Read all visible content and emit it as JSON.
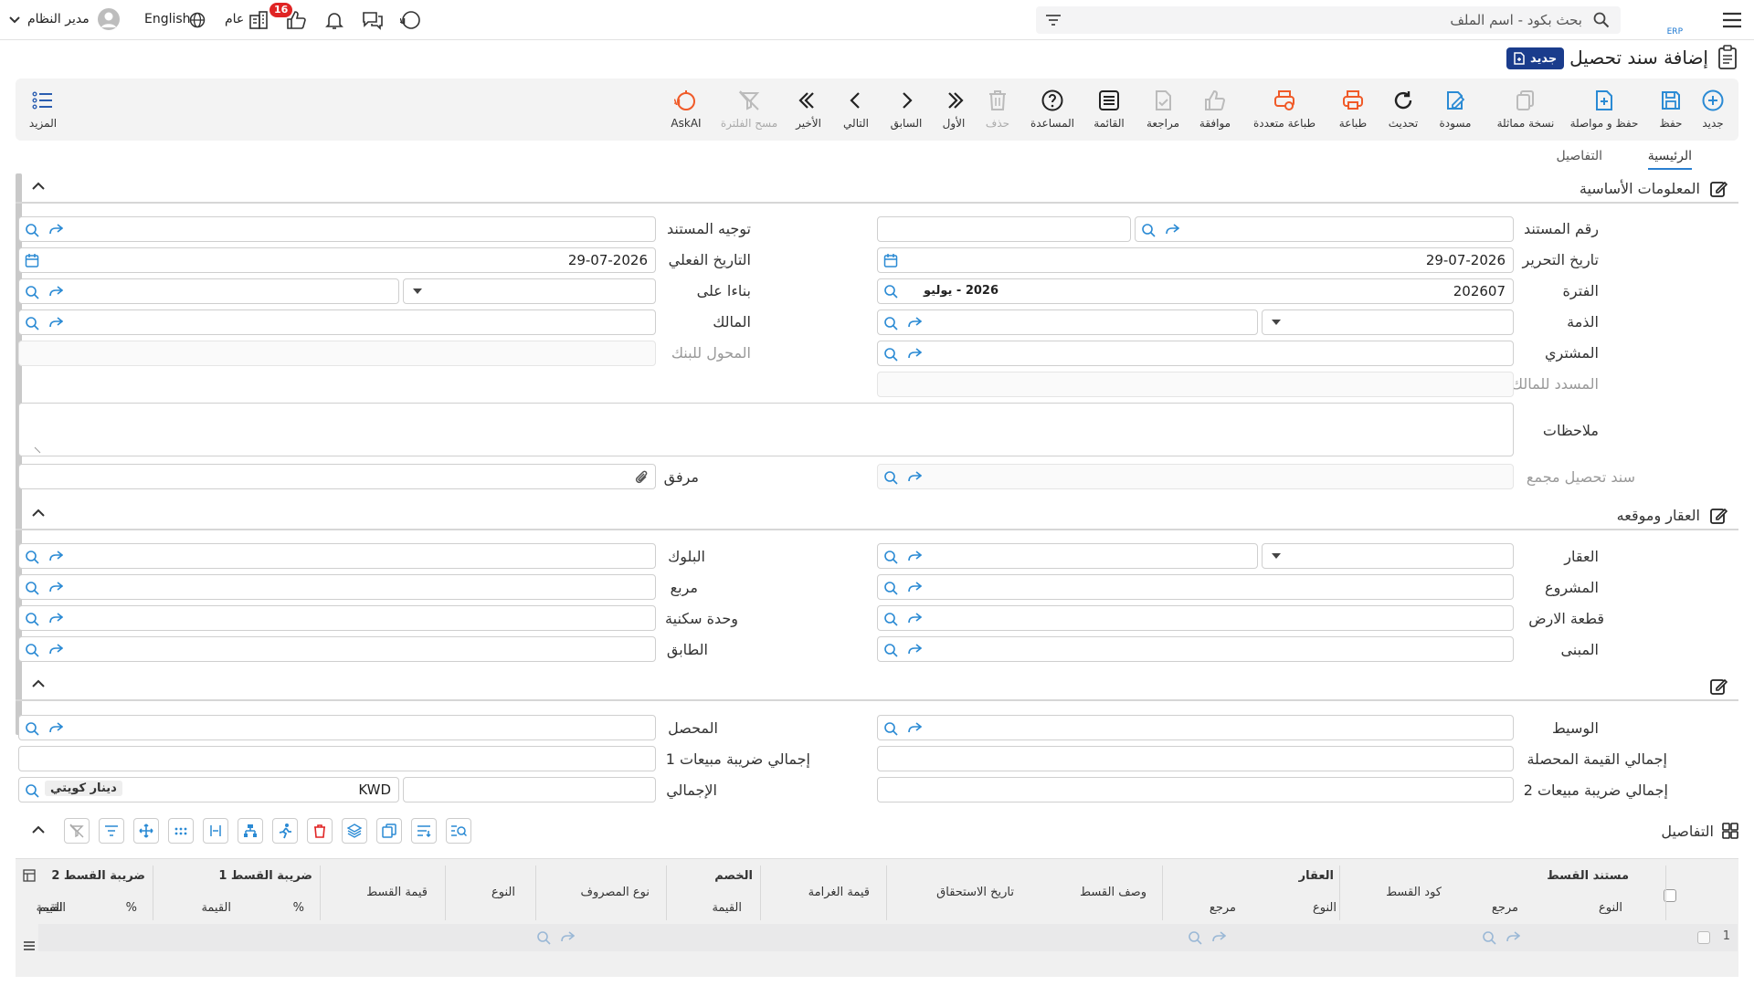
{
  "topbar": {
    "search_placeholder": "بحث بكود - اسم الملف",
    "user_name": "مدير النظام",
    "language": "English",
    "scope": "عام",
    "notif_count": "16"
  },
  "page": {
    "title": "إضافة سند تحصيل",
    "new_badge": "جديد"
  },
  "toolbar": {
    "items": [
      {
        "label": "جديد",
        "icon": "plus-circle-icon"
      },
      {
        "label": "حفظ",
        "icon": "save-icon"
      },
      {
        "label": "حفظ و مواصلة",
        "icon": "save-continue-icon"
      },
      {
        "label": "نسخة مماثلة",
        "icon": "copy-icon"
      },
      {
        "label": "مسودة",
        "icon": "draft-icon"
      },
      {
        "label": "تحديث",
        "icon": "refresh-icon"
      },
      {
        "label": "طباعة",
        "icon": "print-icon"
      },
      {
        "label": "طباعة متعددة",
        "icon": "multi-print-icon"
      },
      {
        "label": "موافقة",
        "icon": "thumbs-up-icon"
      },
      {
        "label": "مراجعة",
        "icon": "review-icon"
      },
      {
        "label": "القائمة",
        "icon": "list-icon"
      },
      {
        "label": "المساعدة",
        "icon": "help-icon"
      },
      {
        "label": "حذف",
        "icon": "trash-icon"
      },
      {
        "label": "الأول",
        "icon": "first-icon"
      },
      {
        "label": "السابق",
        "icon": "prev-icon"
      },
      {
        "label": "التالي",
        "icon": "next-icon"
      },
      {
        "label": "الأخير",
        "icon": "last-icon"
      },
      {
        "label": "مسح الفلترة",
        "icon": "clear-filter-icon"
      },
      {
        "label": "AskAI",
        "icon": "askai-icon"
      }
    ],
    "more": "المزيد"
  },
  "tabs": {
    "main": "الرئيسية",
    "details": "التفاصيل"
  },
  "sections": {
    "basic": "المعلومات الأساسية",
    "property": "العقار وموقعه"
  },
  "fields": {
    "doc_number": "رقم المستند",
    "doc_direction": "توجيه المستند",
    "edit_date": "تاريخ التحرير",
    "edit_date_value": "29-07-2026",
    "actual_date": "التاريخ الفعلي",
    "actual_date_value": "29-07-2026",
    "period": "الفترة",
    "period_value": "202607",
    "period_name": "2026 - يوليو",
    "based_on": "بناءا على",
    "account": "الذمة",
    "owner": "المالك",
    "buyer": "المشتري",
    "bank_transfer": "المحول للبنك",
    "paid_to_owner": "المسدد للمالك",
    "notes": "ملاحظات",
    "grouped_receipt": "سند تحصيل مجمع",
    "attachment": "مرفق",
    "property": "العقار",
    "block": "البلوك",
    "project": "المشروع",
    "square": "مربع",
    "land_plot": "قطعة الارض",
    "housing_unit": "وحدة سكنية",
    "building": "المبنى",
    "floor": "الطابق",
    "broker": "الوسيط",
    "collector": "المحصل",
    "total_collected": "إجمالي القيمة المحصلة",
    "total_vat1": "إجمالي ضريبة مبيعات 1",
    "total_vat2": "إجمالي ضريبة مبيعات 2",
    "total": "الإجمالي",
    "currency_code": "KWD",
    "currency_name": "دينار كويتي"
  },
  "details": {
    "title": "التفاصيل",
    "groups": [
      "مستند القسط",
      "العقار",
      "الخصم",
      "ضريبة القسط 1",
      "ضريبة القسط 2"
    ],
    "columns": [
      "النوع",
      "مرجع",
      "كود القسط",
      "النوع",
      "مرجع",
      "وصف القسط",
      "تاريخ الاستحقاق",
      "قيمة الغرامة",
      "القيمة",
      "نوع المصروف",
      "النوع",
      "قيمة القسط",
      "%",
      "القيمة",
      "%",
      "القيمة",
      "القيم"
    ],
    "row_number": "1"
  }
}
